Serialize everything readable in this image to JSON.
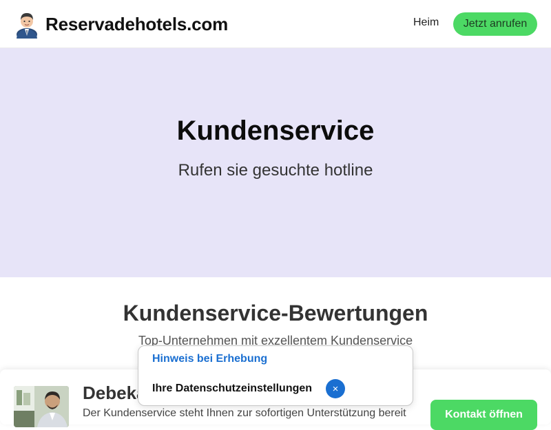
{
  "header": {
    "brand_name": "Reservadehotels.com",
    "logo_icon": "businessman-icon",
    "nav_home": "Heim",
    "cta_label": "Jetzt anrufen"
  },
  "hero": {
    "title": "Kundenservice",
    "subtitle": "Rufen sie gesuchte hotline"
  },
  "reviews": {
    "title": "Kundenservice-Bewertungen",
    "subtitle": "Top-Unternehmen mit exzellentem Kundenservice",
    "card": {
      "title": "Debeka",
      "text": "Der Kundenservice steht Ihnen zur sofortigen Unterstützung bereit",
      "button_label": "Kontakt öffnen"
    }
  },
  "privacy": {
    "link_label": "Hinweis bei Erhebung",
    "settings_label": "Ihre Datenschutzeinstellungen",
    "close_symbol": "×"
  },
  "colors": {
    "accent_green": "#4cd964",
    "hero_bg": "#e7e4f8",
    "link_blue": "#1a6fd1"
  }
}
